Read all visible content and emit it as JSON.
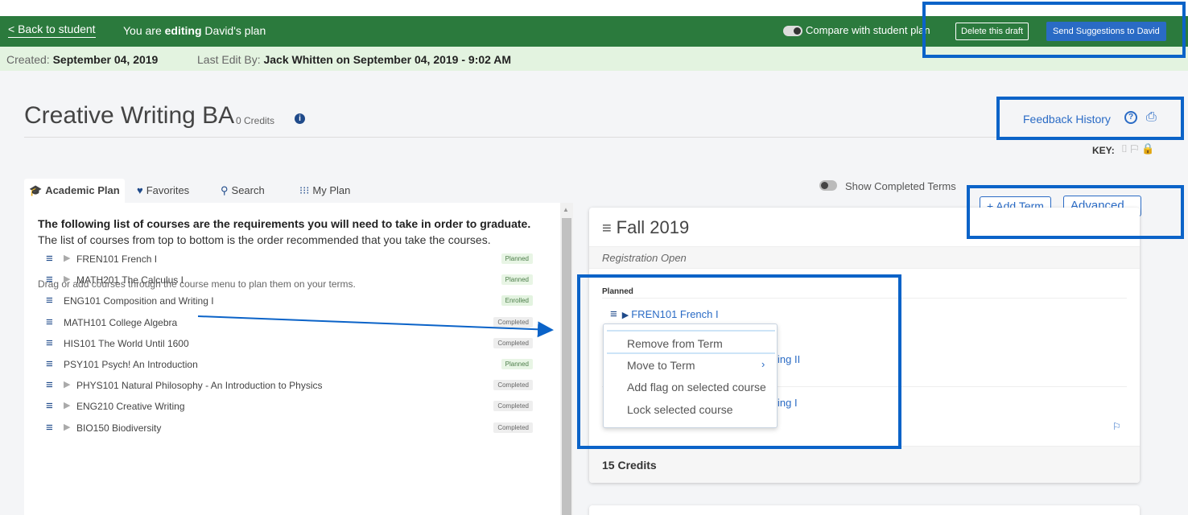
{
  "topbar": {
    "back_label": "< Back to student",
    "editing_prefix": "You are ",
    "editing_bold": "editing",
    "editing_suffix": " David's plan",
    "compare_label": "Compare with student plan",
    "delete_label": "Delete this draft",
    "send_label": "Send Suggestions to David",
    "color": "#2b7a3d"
  },
  "infobar": {
    "created_label": "Created:",
    "created_value": "September 04, 2019",
    "edit_label": "Last Edit By:",
    "edit_value": "Jack Whitten on September 04, 2019 - 9:02 AM"
  },
  "header": {
    "title": "Creative Writing BA",
    "credits": "0 Credits",
    "info_icon": "i",
    "feedback_label": "Feedback History",
    "help_icon": "?",
    "print_icon": "⎙",
    "key_label": "KEY:",
    "key_icons": [
      "⌷",
      "⚐"
    ],
    "key_lock": "🔒"
  },
  "tabs": [
    {
      "icon": "🎓",
      "label": "Academic Plan",
      "icon_name": "graduation-cap-icon"
    },
    {
      "icon": "♥",
      "label": "Favorites",
      "icon_name": "heart-icon"
    },
    {
      "icon": "⚲",
      "label": "Search",
      "icon_name": "search-icon"
    },
    {
      "icon": "⁝⁝⁝",
      "label": "My Plan",
      "icon_name": "grid-dots-icon"
    }
  ],
  "left": {
    "intro_bold": "The following list of courses are the requirements you will need to take in order to graduate.",
    "intro_rest": " The list of courses from top to bottom is the order recommended that you take the courses.",
    "drag_note": "Drag or add courses through the course menu to plan them on your terms.",
    "courses": [
      {
        "name": "FREN101 French I",
        "status": "Planned",
        "arrow": true
      },
      {
        "name": "MATH201 The Calculus I",
        "status": "Planned",
        "arrow": true
      },
      {
        "name": "ENG101 Composition and Writing I",
        "status": "Enrolled",
        "arrow": false
      },
      {
        "name": "MATH101 College Algebra",
        "status": "Completed",
        "arrow": false
      },
      {
        "name": "HIS101 The World Until 1600",
        "status": "Completed",
        "arrow": false
      },
      {
        "name": "PSY101 Psych! An Introduction",
        "status": "Planned",
        "arrow": false
      },
      {
        "name": "PHYS101 Natural Philosophy - An Introduction to Physics",
        "status": "Completed",
        "arrow": true
      },
      {
        "name": "ENG210 Creative Writing",
        "status": "Completed",
        "arrow": true
      },
      {
        "name": "BIO150 Biodiversity",
        "status": "Completed",
        "arrow": true
      }
    ]
  },
  "right": {
    "show_completed_label": "Show Completed Terms",
    "add_term_label": "+ Add Term",
    "advanced_label": "Advanced...",
    "term": {
      "name": "Fall 2019",
      "status": "Registration Open",
      "planned_label": "Planned",
      "course": "FREN101 French I",
      "frag1": "ing II",
      "frag2": "ing I",
      "credits": "15 Credits"
    },
    "context_menu": [
      "Remove from Term",
      "Move to Term",
      "Add flag on selected course",
      "Lock selected course"
    ],
    "chevron": "›"
  },
  "highlight_color": "#0b63c8"
}
